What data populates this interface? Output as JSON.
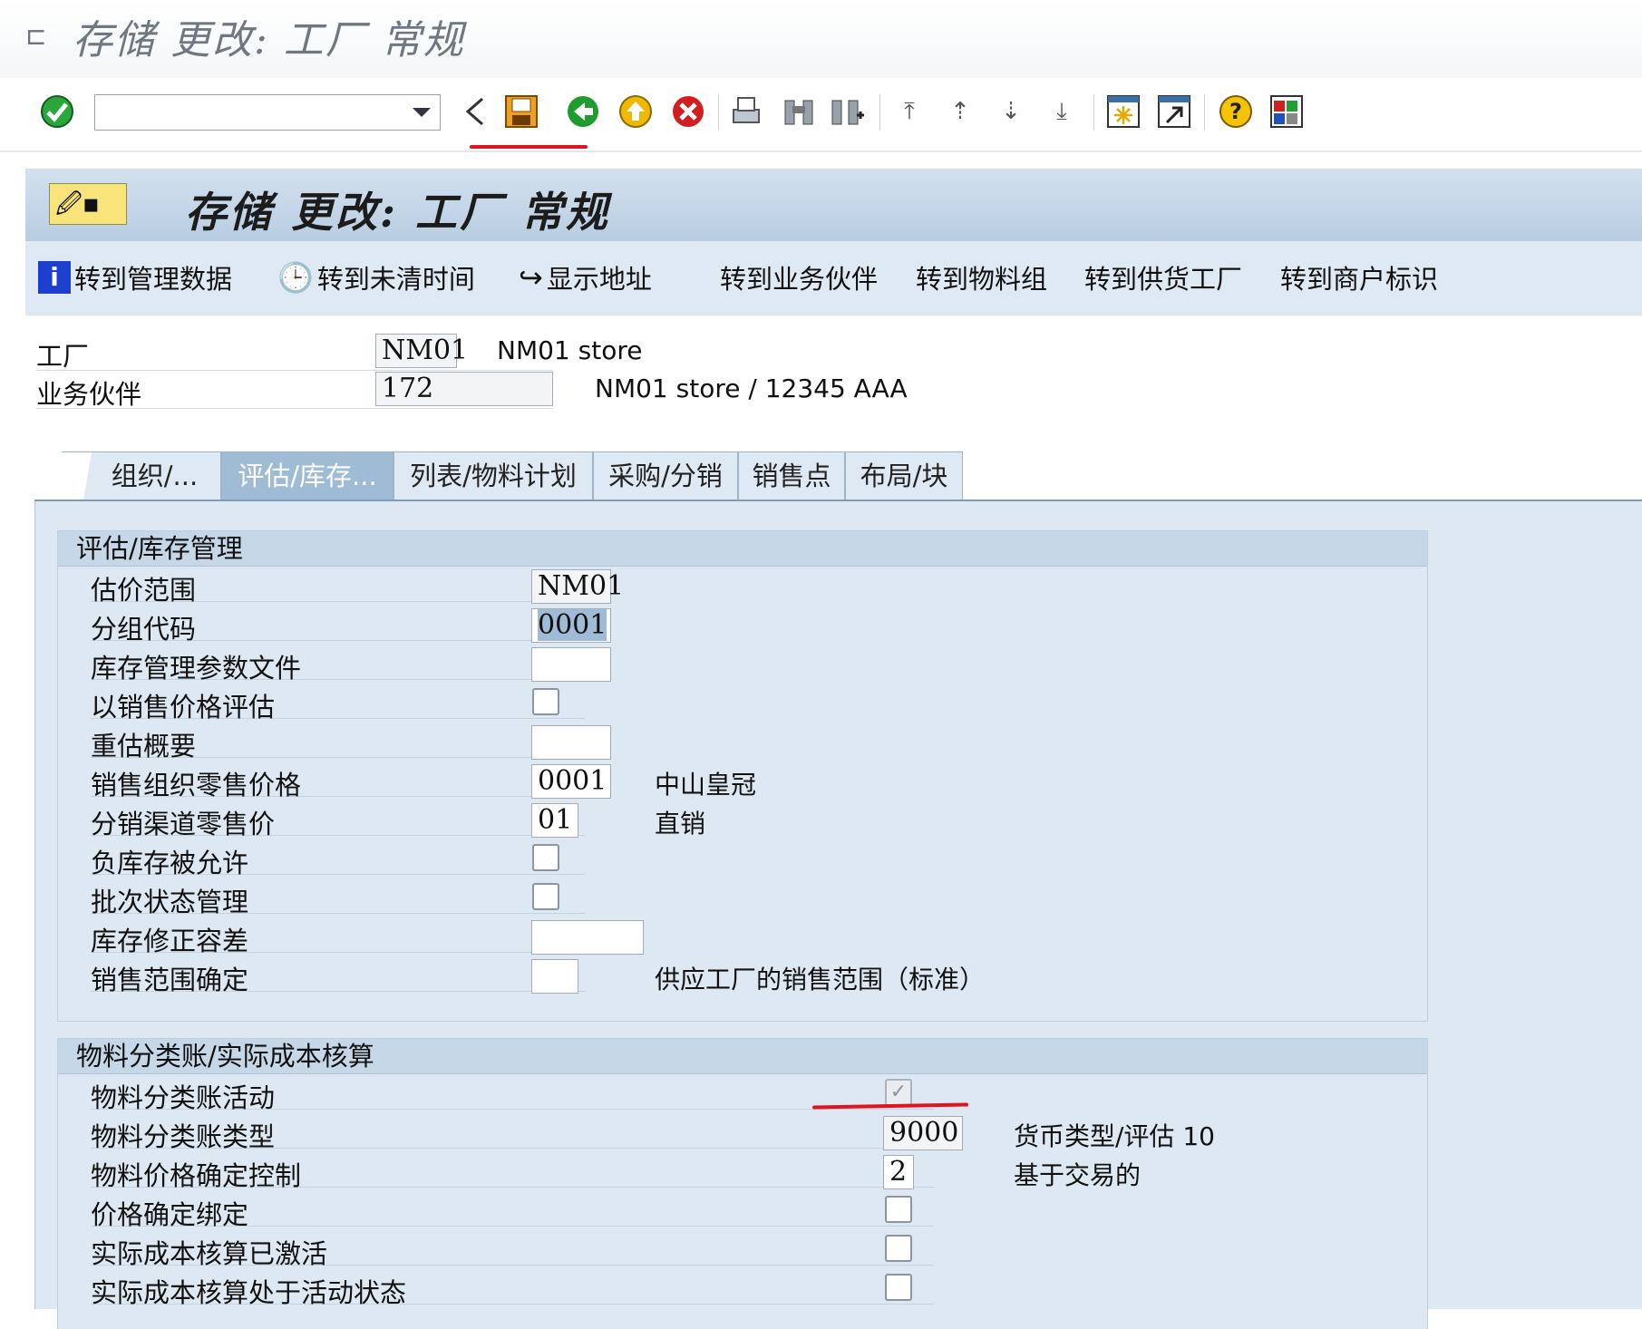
{
  "window": {
    "title": "存储 更改: 工厂 常规"
  },
  "toolbar": {
    "command_value": "",
    "icons": [
      "enter-icon",
      "back-arrow-icon",
      "save-icon",
      "back-icon",
      "exit-icon",
      "cancel-icon",
      "print-icon",
      "find-icon",
      "find-next-icon",
      "first-page-icon",
      "previous-page-icon",
      "next-page-icon",
      "last-page-icon",
      "new-session-icon",
      "shortcut-icon",
      "help-icon",
      "customize-layout-icon"
    ]
  },
  "panel": {
    "title": "存储 更改: 工厂 常规"
  },
  "app_toolbar": {
    "items": [
      "转到管理数据",
      "转到未清时间",
      "显示地址",
      "转到业务伙伴",
      "转到物料组",
      "转到供货工厂",
      "转到商户标识"
    ]
  },
  "header": {
    "plant_label": "工厂",
    "plant_value": "NM01",
    "plant_desc": "NM01 store",
    "partner_label": "业务伙伴",
    "partner_value": "172",
    "partner_desc": "NM01 store / 12345 AAA"
  },
  "tabs": [
    "组织/...",
    "评估/库存...",
    "列表/物料计划",
    "采购/分销",
    "销售点",
    "布局/块"
  ],
  "active_tab": "评估/库存...",
  "group1": {
    "title": "评估/库存管理",
    "rows": [
      {
        "label": "估价范围",
        "value": "NM01",
        "desc": ""
      },
      {
        "label": "分组代码",
        "value": "0001",
        "desc": ""
      },
      {
        "label": "库存管理参数文件",
        "value": "",
        "desc": ""
      },
      {
        "label": "以销售价格评估",
        "checked": false
      },
      {
        "label": "重估概要",
        "value": "",
        "desc": ""
      },
      {
        "label": "销售组织零售价格",
        "value": "0001",
        "desc": "中山皇冠"
      },
      {
        "label": "分销渠道零售价",
        "value": "01",
        "desc": "直销"
      },
      {
        "label": "负库存被允许",
        "checked": false
      },
      {
        "label": "批次状态管理",
        "checked": false
      },
      {
        "label": "库存修正容差",
        "value": "",
        "desc": ""
      },
      {
        "label": "销售范围确定",
        "value": "",
        "desc": "供应工厂的销售范围（标准）"
      }
    ]
  },
  "group2": {
    "title": "物料分类账/实际成本核算",
    "rows": [
      {
        "label": "物料分类账活动",
        "checked": true
      },
      {
        "label": "物料分类账类型",
        "value": "9000",
        "desc": "货币类型/评估 10"
      },
      {
        "label": "物料价格确定控制",
        "value": "2",
        "desc": "基于交易的"
      },
      {
        "label": "价格确定绑定",
        "checked": false
      },
      {
        "label": "实际成本核算已激活",
        "checked": false
      },
      {
        "label": "实际成本核算处于活动状态",
        "checked": false
      }
    ]
  },
  "colors": {
    "accent_red": "#e0141e",
    "panel_blue": "#dde8f3",
    "tab_active": "#9fbbd6"
  }
}
